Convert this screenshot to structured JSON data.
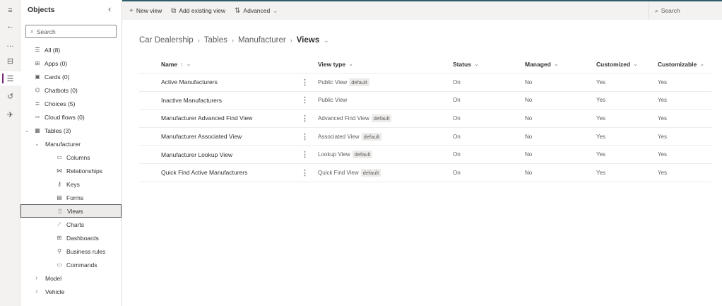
{
  "rail": {
    "items": [
      {
        "icon": "hamburger-icon",
        "glyph": "≡"
      },
      {
        "icon": "back-arrow-icon",
        "glyph": "←"
      },
      {
        "icon": "more-icon",
        "glyph": "…"
      },
      {
        "icon": "book-icon",
        "glyph": "⊟"
      },
      {
        "icon": "object-tree-icon",
        "glyph": "☰"
      },
      {
        "icon": "history-icon",
        "glyph": "↺"
      },
      {
        "icon": "rocket-icon",
        "glyph": "✈"
      }
    ]
  },
  "sidebar": {
    "title": "Objects",
    "search_placeholder": "Search",
    "items": [
      {
        "label": "All (8)",
        "icon": "list-icon",
        "glyph": "☰"
      },
      {
        "label": "Apps (0)",
        "icon": "apps-icon",
        "glyph": "⊞"
      },
      {
        "label": "Cards (0)",
        "icon": "cards-icon",
        "glyph": "▣"
      },
      {
        "label": "Chatbots (0)",
        "icon": "chatbot-icon",
        "glyph": "⌬"
      },
      {
        "label": "Choices (5)",
        "icon": "choices-icon",
        "glyph": "≣"
      },
      {
        "label": "Cloud flows (0)",
        "icon": "flow-icon",
        "glyph": "∾"
      },
      {
        "label": "Tables (3)",
        "icon": "table-icon",
        "glyph": "▦"
      },
      {
        "label": "Manufacturer"
      },
      {
        "label": "Columns",
        "icon": "columns-icon",
        "glyph": "▭"
      },
      {
        "label": "Relationships",
        "icon": "relationships-icon",
        "glyph": "⋈"
      },
      {
        "label": "Keys",
        "icon": "key-icon",
        "glyph": "⚷"
      },
      {
        "label": "Forms",
        "icon": "forms-icon",
        "glyph": "▤"
      },
      {
        "label": "Views",
        "icon": "views-icon",
        "glyph": "▯"
      },
      {
        "label": "Charts",
        "icon": "charts-icon",
        "glyph": "⟋"
      },
      {
        "label": "Dashboards",
        "icon": "dashboards-icon",
        "glyph": "⊞"
      },
      {
        "label": "Business rules",
        "icon": "business-rules-icon",
        "glyph": "⚲"
      },
      {
        "label": "Commands",
        "icon": "commands-icon",
        "glyph": "▭"
      },
      {
        "label": "Model"
      },
      {
        "label": "Vehicle"
      }
    ]
  },
  "toolbar": {
    "new_view": "New view",
    "add_existing": "Add existing view",
    "advanced": "Advanced",
    "search": "Search"
  },
  "breadcrumb": [
    "Car Dealership",
    "Tables",
    "Manufacturer",
    "Views"
  ],
  "table": {
    "columns": [
      "Name",
      "View type",
      "Status",
      "Managed",
      "Customized",
      "Customizable"
    ],
    "sort_indicator": "↑",
    "rows": [
      {
        "name": "Active Manufacturers",
        "type": "Public View",
        "badge": "default",
        "status": "On",
        "managed": "No",
        "customized": "Yes",
        "customizable": "Yes"
      },
      {
        "name": "Inactive Manufacturers",
        "type": "Public View",
        "badge": null,
        "status": "On",
        "managed": "No",
        "customized": "Yes",
        "customizable": "Yes"
      },
      {
        "name": "Manufacturer Advanced Find View",
        "type": "Advanced Find View",
        "badge": "default",
        "status": "On",
        "managed": "No",
        "customized": "Yes",
        "customizable": "Yes"
      },
      {
        "name": "Manufacturer Associated View",
        "type": "Associated View",
        "badge": "default",
        "status": "On",
        "managed": "No",
        "customized": "Yes",
        "customizable": "Yes"
      },
      {
        "name": "Manufacturer Lookup View",
        "type": "Lookup View",
        "badge": "default",
        "status": "On",
        "managed": "No",
        "customized": "Yes",
        "customizable": "Yes"
      },
      {
        "name": "Quick Find Active Manufacturers",
        "type": "Quick Find View",
        "badge": "default",
        "status": "On",
        "managed": "No",
        "customized": "Yes",
        "customizable": "Yes"
      }
    ]
  },
  "colors": {
    "accent": "#742774",
    "toolbar_bg": "#f3f2f1",
    "selected_bg": "#edebe9"
  }
}
